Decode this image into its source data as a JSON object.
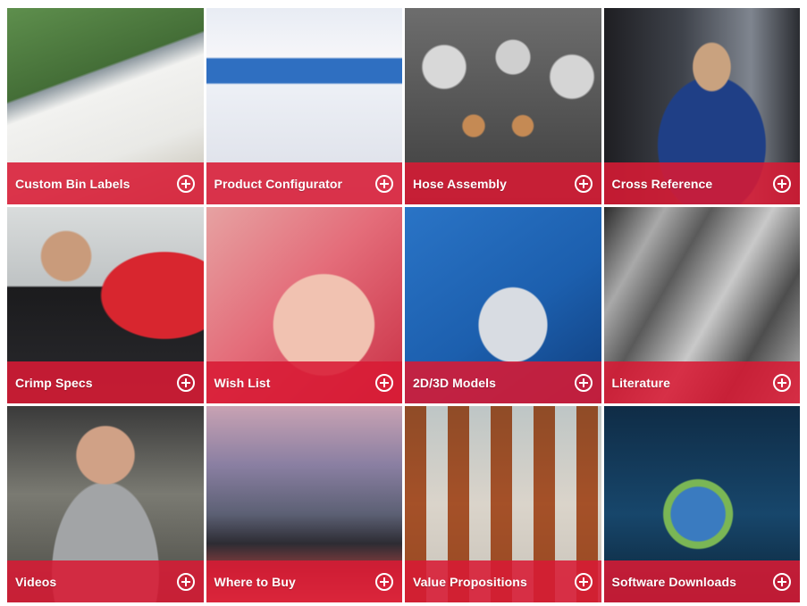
{
  "tiles": [
    {
      "label": "Custom Bin Labels",
      "icon": "plus-circle-icon"
    },
    {
      "label": "Product Configurator",
      "icon": "plus-circle-icon"
    },
    {
      "label": "Hose Assembly",
      "icon": "plus-circle-icon"
    },
    {
      "label": "Cross Reference",
      "icon": "plus-circle-icon"
    },
    {
      "label": "Crimp Specs",
      "icon": "plus-circle-icon"
    },
    {
      "label": "Wish List",
      "icon": "plus-circle-icon"
    },
    {
      "label": "2D/3D Models",
      "icon": "plus-circle-icon"
    },
    {
      "label": "Literature",
      "icon": "plus-circle-icon"
    },
    {
      "label": "Videos",
      "icon": "plus-circle-icon"
    },
    {
      "label": "Where to Buy",
      "icon": "plus-circle-icon"
    },
    {
      "label": "Value Propositions",
      "icon": "plus-circle-icon"
    },
    {
      "label": "Software Downloads",
      "icon": "plus-circle-icon"
    }
  ],
  "colors": {
    "bar": "#d81a34",
    "text": "#ffffff"
  }
}
